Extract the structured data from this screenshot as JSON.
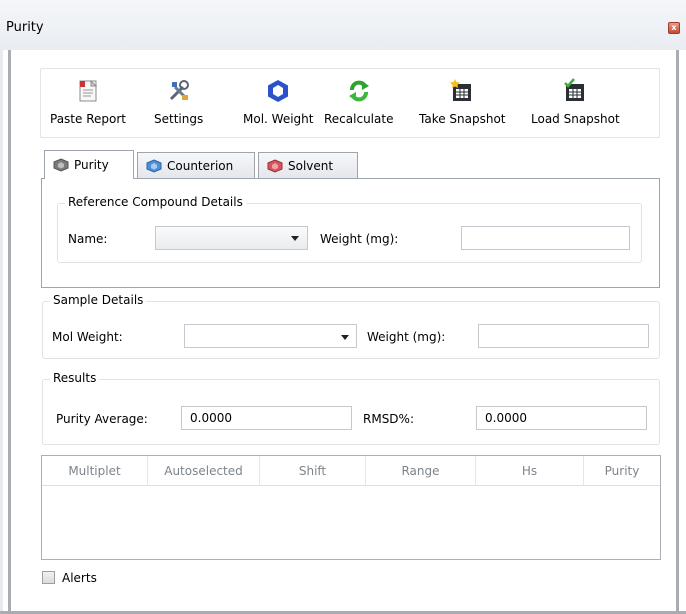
{
  "window": {
    "title": "Purity",
    "close_glyph": "x"
  },
  "toolbar": {
    "items": [
      {
        "label": "Paste Report",
        "icon": "paste-report-icon"
      },
      {
        "label": "Settings",
        "icon": "settings-tools-icon"
      },
      {
        "label": "Mol. Weight",
        "icon": "hexagon-molecule-icon"
      },
      {
        "label": "Recalculate",
        "icon": "recalculate-arrows-icon"
      },
      {
        "label": "Take Snapshot",
        "icon": "take-snapshot-icon"
      },
      {
        "label": "Load Snapshot",
        "icon": "load-snapshot-icon"
      }
    ]
  },
  "tabs": [
    {
      "label": "Purity",
      "active": true,
      "icon_color": "#7a7a7a"
    },
    {
      "label": "Counterion",
      "active": false,
      "icon_color": "#4f8fd6"
    },
    {
      "label": "Solvent",
      "active": false,
      "icon_color": "#d6545e"
    }
  ],
  "reference": {
    "title": "Reference Compound Details",
    "name_label": "Name:",
    "name_value": "",
    "weight_label": "Weight (mg):",
    "weight_value": ""
  },
  "sample": {
    "title": "Sample Details",
    "mol_weight_label": "Mol Weight:",
    "mol_weight_value": "",
    "weight_label": "Weight (mg):",
    "weight_value": ""
  },
  "results": {
    "title": "Results",
    "purity_avg_label": "Purity Average:",
    "purity_avg_value": "0.0000",
    "rmsd_label": "RMSD%:",
    "rmsd_value": "0.0000"
  },
  "table": {
    "columns": [
      "Multiplet",
      "Autoselected",
      "Shift",
      "Range",
      "Hs",
      "Purity"
    ],
    "rows": []
  },
  "alerts": {
    "label": "Alerts",
    "checked": false
  }
}
